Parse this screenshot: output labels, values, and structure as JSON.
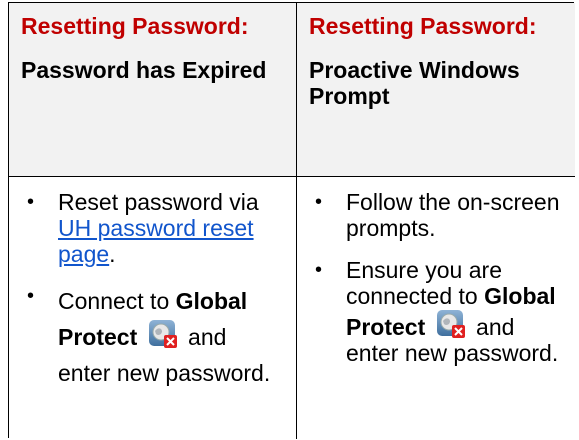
{
  "columns": [
    {
      "heading": "Resetting Password:",
      "subheading": "Password has Expired",
      "bullets": [
        {
          "before": "Reset password via ",
          "link": "UH password reset page",
          "after": "."
        },
        {
          "before": "Connect to ",
          "bold": "Global Protect",
          "after": " and enter new password."
        }
      ]
    },
    {
      "heading": "Resetting Password:",
      "subheading": "Proactive Windows Prompt",
      "bullets": [
        {
          "text": "Follow the on-screen prompts."
        },
        {
          "before": "Ensure you are connected to ",
          "bold": "Global Protect",
          "after": " and enter new password."
        }
      ]
    }
  ],
  "bullet_glyph": "•",
  "colors": {
    "heading": "#c00000",
    "link": "#1155cc",
    "header_bg": "#f2f2f2"
  },
  "icons": [
    "global-protect-icon",
    "global-protect-icon"
  ]
}
